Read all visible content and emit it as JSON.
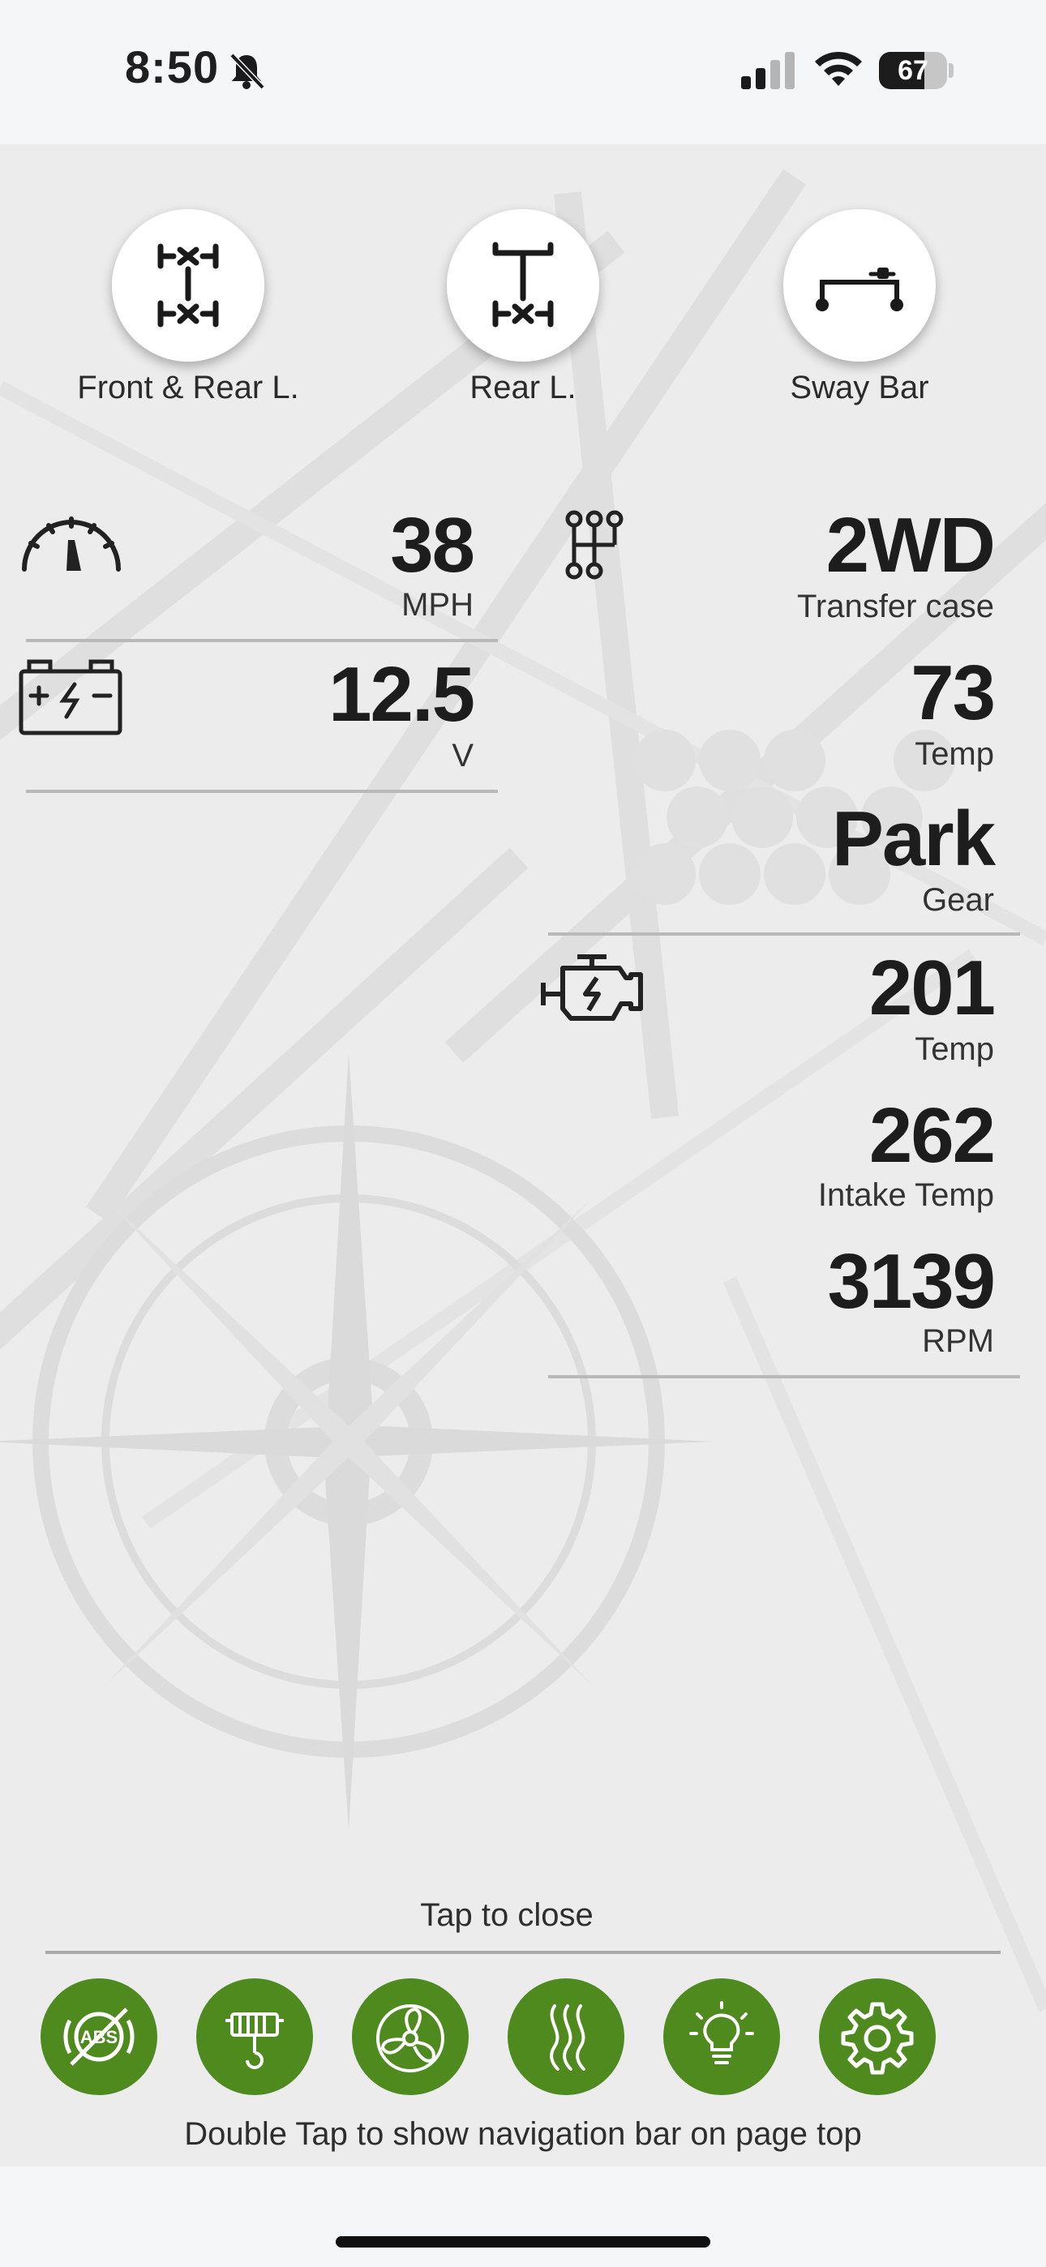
{
  "status_bar": {
    "time": "8:50",
    "battery": "67",
    "battery_level": 0.67,
    "icons": [
      "bell-slash-icon",
      "cellular-signal-icon",
      "wifi-icon",
      "battery-icon"
    ]
  },
  "locks": [
    {
      "label": "Front & Rear L.",
      "icon": "front-rear-locker-icon"
    },
    {
      "label": "Rear L.",
      "icon": "rear-locker-icon"
    },
    {
      "label": "Sway Bar",
      "icon": "sway-bar-icon"
    }
  ],
  "readings": {
    "speed": {
      "value": "38",
      "unit": "MPH",
      "icon": "speedometer-icon"
    },
    "battery": {
      "value": "12.5",
      "unit": "V",
      "icon": "car-battery-icon"
    },
    "transfer": {
      "value": "2WD",
      "unit": "Transfer case",
      "icon": "gear-shift-pattern-icon"
    },
    "transfer_temp": {
      "value": "73",
      "unit": "Temp"
    },
    "gear": {
      "value": "Park",
      "unit": "Gear"
    },
    "engine_temp": {
      "value": "201",
      "unit": "Temp",
      "icon": "engine-icon"
    },
    "intake_temp": {
      "value": "262",
      "unit": "Intake Temp"
    },
    "rpm": {
      "value": "3139",
      "unit": "RPM"
    }
  },
  "bottom": {
    "tap_to_close": "Tap to close",
    "buttons": [
      "abs-off-icon",
      "winch-icon",
      "fan-icon",
      "heat-waves-icon",
      "light-bulb-icon",
      "settings-gear-icon"
    ],
    "accent_color": "#4e8a1e",
    "hint": "Double Tap to show navigation bar on page top"
  }
}
